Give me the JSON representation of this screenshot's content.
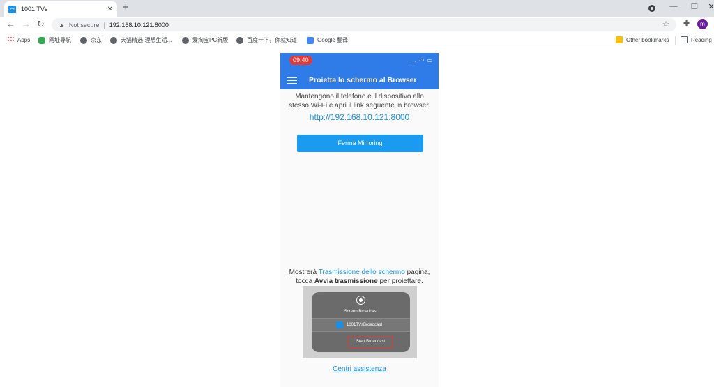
{
  "browser": {
    "tab_title": "1001 TVs",
    "tab_favicon": "tv-icon",
    "new_tab": "+",
    "security_label": "Not secure",
    "separator": "|",
    "url": "192.168.10.121:8000",
    "profile_initial": "m",
    "bookmarks": [
      {
        "label": "Apps",
        "icon": "apps-icon"
      },
      {
        "label": "网址导航",
        "icon": "car-icon"
      },
      {
        "label": "京东",
        "icon": "globe-icon"
      },
      {
        "label": "天猫精选-理想生活...",
        "icon": "globe-icon"
      },
      {
        "label": "爱淘宝PC新版",
        "icon": "globe-icon"
      },
      {
        "label": "百度一下，你就知道",
        "icon": "globe-icon"
      },
      {
        "label": "Google 翻译",
        "icon": "google-translate-icon"
      }
    ],
    "other_bookmarks": "Other bookmarks",
    "reading_list": "Reading"
  },
  "app": {
    "status_time": "09:40",
    "title": "Proietta lo schermo al Browser",
    "intro": "Mantengono il telefono e il dispositivo allo stesso Wi-Fi e apri il link seguente in browser.",
    "link_url": "http://192.168.10.121:8000",
    "stop_button": "Ferma Mirroring",
    "instr_prefix": "Mostrerà ",
    "instr_highlight": "Trasmissione dello schermo",
    "instr_mid": " pagina,",
    "instr_line2_prefix": "tocca ",
    "instr_bold": "Avvia trasmissione",
    "instr_suffix": " per proiettare.",
    "sheet_title": "Screen Broadcast",
    "sheet_app": "1001TVsBroadcast",
    "sheet_start": "Start Broadcast",
    "help_link": "Centri assistenza"
  },
  "colors": {
    "appbar": "#2f7be8",
    "button": "#1a9bf0",
    "link": "#1a8fe3",
    "time_badge": "#e53935"
  }
}
